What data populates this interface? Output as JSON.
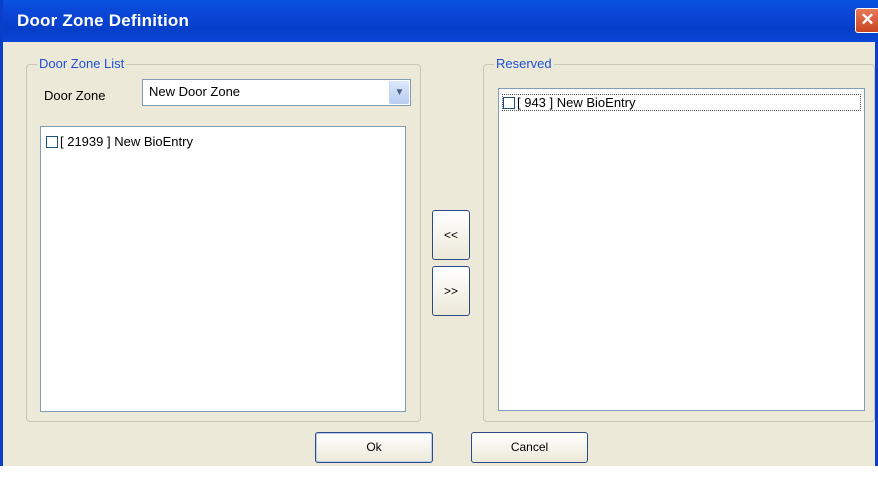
{
  "window": {
    "title": "Door Zone Definition"
  },
  "icons": {
    "close": "close-icon",
    "dropdown": "chevron-down-icon",
    "checkbox": "checkbox-icon"
  },
  "door_zone_list": {
    "group_label": "Door Zone List",
    "zone_label": "Door Zone",
    "zone_selected": "New Door Zone",
    "items": [
      {
        "text": "[ 21939 ] New BioEntry",
        "checked": false
      }
    ]
  },
  "reserved": {
    "group_label": "Reserved",
    "items": [
      {
        "text": "[ 943 ] New BioEntry",
        "checked": false
      }
    ]
  },
  "buttons": {
    "move_left": "<<",
    "move_right": ">>",
    "ok": "Ok",
    "cancel": "Cancel"
  }
}
